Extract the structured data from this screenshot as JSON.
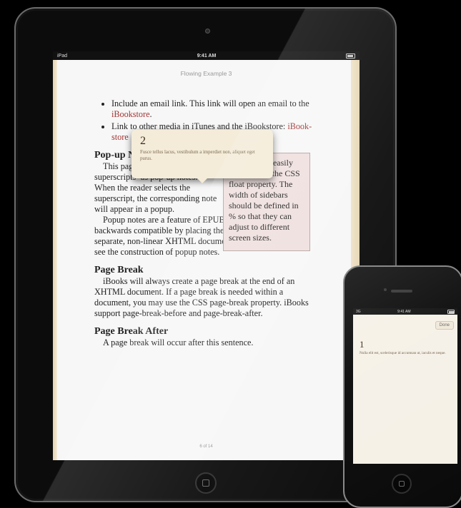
{
  "ipad": {
    "status": {
      "carrier": "iPad",
      "time": "9:41 AM"
    },
    "book_title": "Flowing Example 3",
    "bullets": [
      {
        "text": "Include an email link. This link will open an email to the ",
        "link": "iBookstore",
        "tail": "."
      },
      {
        "text": "Link to other media in iTunes and the iBookstore: ",
        "link": "iBook-store",
        "tail": ""
      }
    ],
    "popup_section": {
      "heading": "Pop-up Notes",
      "paras": [
        "This page has footnote-style superscripts¹ as pop-up notes. When the reader selects the superscript, the corresponding note will appear in a popup.",
        "Popup notes are a feature of EPUB 3, but can be made backwards compatible by placing the popup text in a separate, non-linear XHTML document. Unzip this EPUB to see the construction of popup notes."
      ]
    },
    "sidebar_text": "Sidebars are easily styled using the CSS float property. The width of sidebars should be defined in % so that they can adjust to different screen sizes.",
    "popup": {
      "number": "2",
      "text": "Fusce tellus lacus, vestibulum a imperdiet non, aliquet eget purus."
    },
    "page_break": {
      "heading": "Page Break",
      "text": "iBooks will always create a page break at the end of an XHTML document. If a page break is needed within a document, you may use the CSS page-break property. iBooks support page-break-before and page-break-after."
    },
    "page_break_after": {
      "heading": "Page Break After",
      "text": "A page break will occur after this sentence."
    },
    "page_number": "6 of 14"
  },
  "iphone": {
    "status": {
      "carrier": "3G",
      "time": "9:41 AM"
    },
    "done_label": "Done",
    "note_number": "1",
    "note_text": "Nulla elit est, scelerisque id accumsan ut, iaculis et neque."
  }
}
